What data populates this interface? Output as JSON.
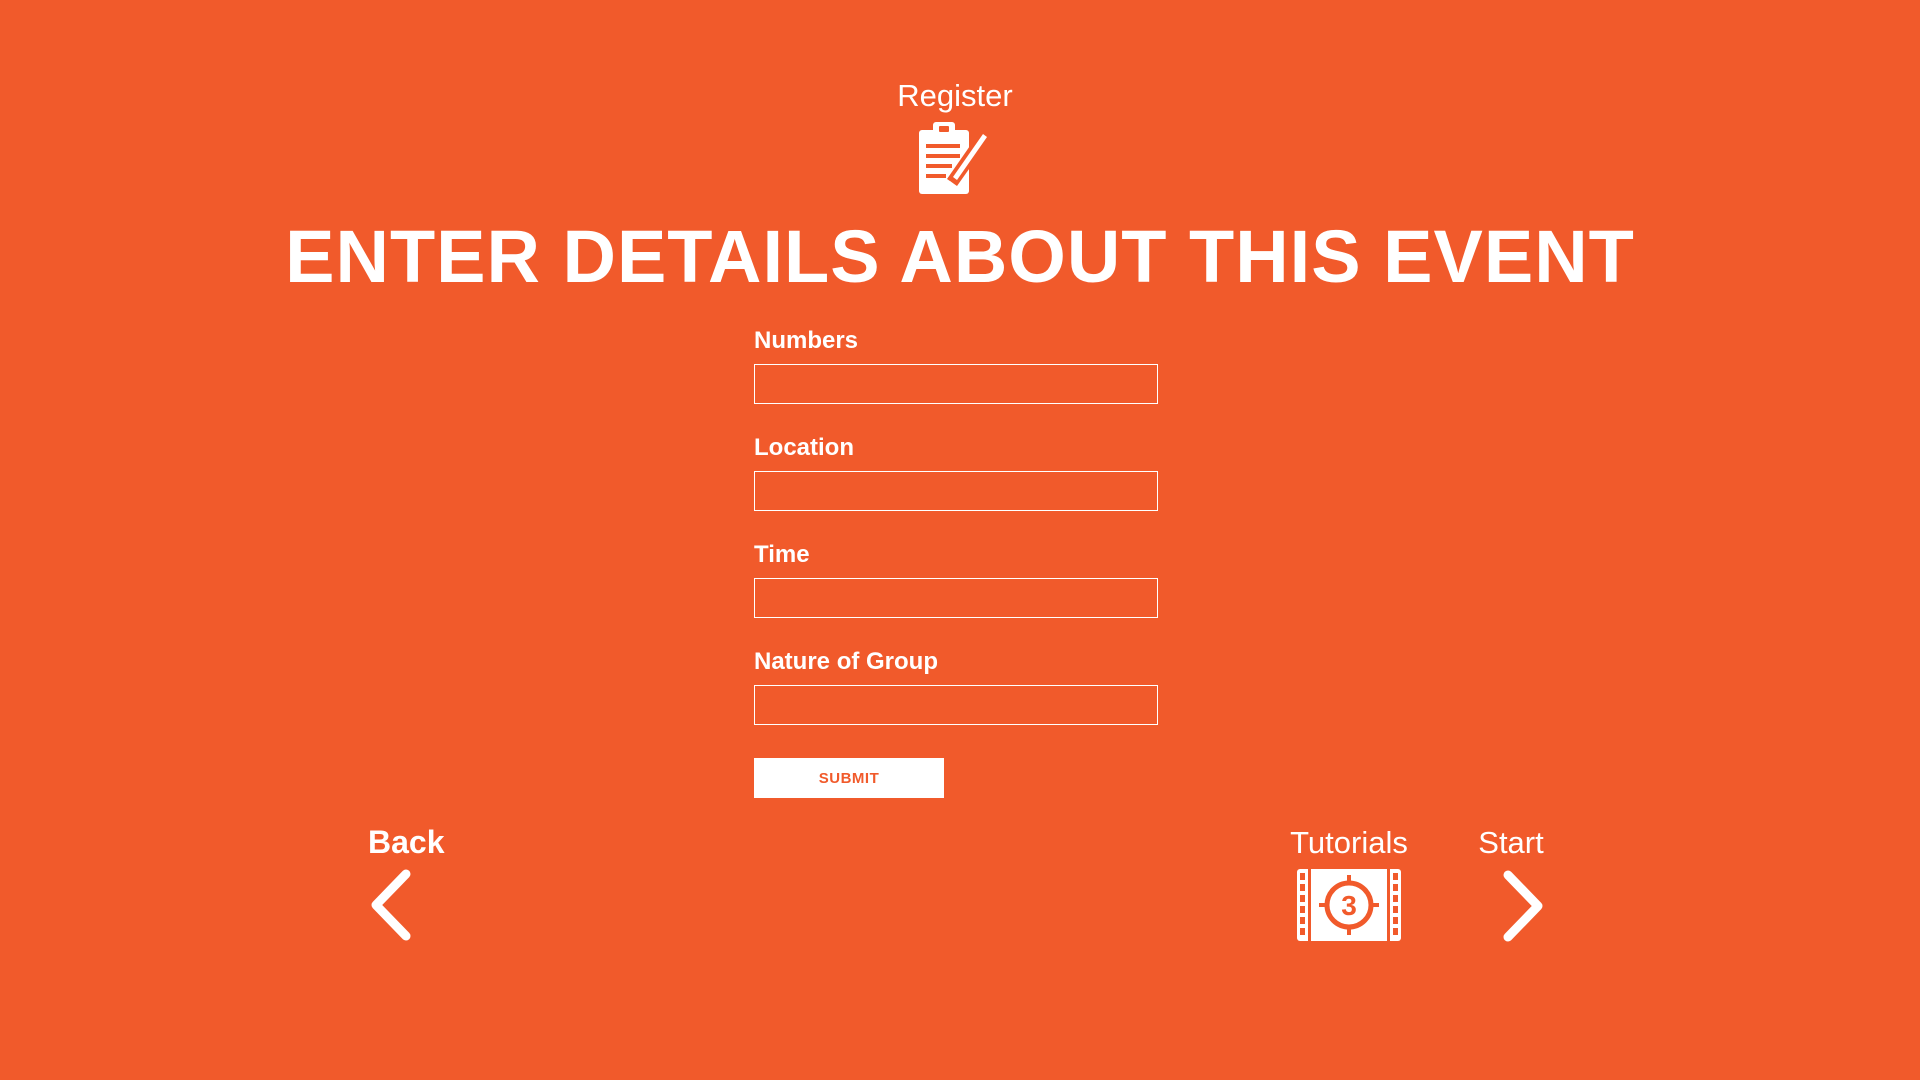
{
  "app": {
    "background_color": "#F15A2B",
    "foreground_color": "#FFFFFF"
  },
  "header": {
    "register_label": "Register",
    "register_icon": "clipboard-edit-icon",
    "title": "ENTER DETAILS ABOUT THIS EVENT"
  },
  "form": {
    "fields": [
      {
        "label": "Numbers",
        "value": "",
        "placeholder": ""
      },
      {
        "label": "Location",
        "value": "",
        "placeholder": ""
      },
      {
        "label": "Time",
        "value": "",
        "placeholder": ""
      },
      {
        "label": "Nature of Group",
        "value": "",
        "placeholder": ""
      }
    ],
    "submit_label": "SUBMIT"
  },
  "nav": {
    "back_label": "Back",
    "back_icon": "chevron-left-icon",
    "tutorials_label": "Tutorials",
    "tutorials_icon": "film-countdown-icon",
    "tutorials_countdown": "3",
    "start_label": "Start",
    "start_icon": "chevron-right-icon"
  }
}
